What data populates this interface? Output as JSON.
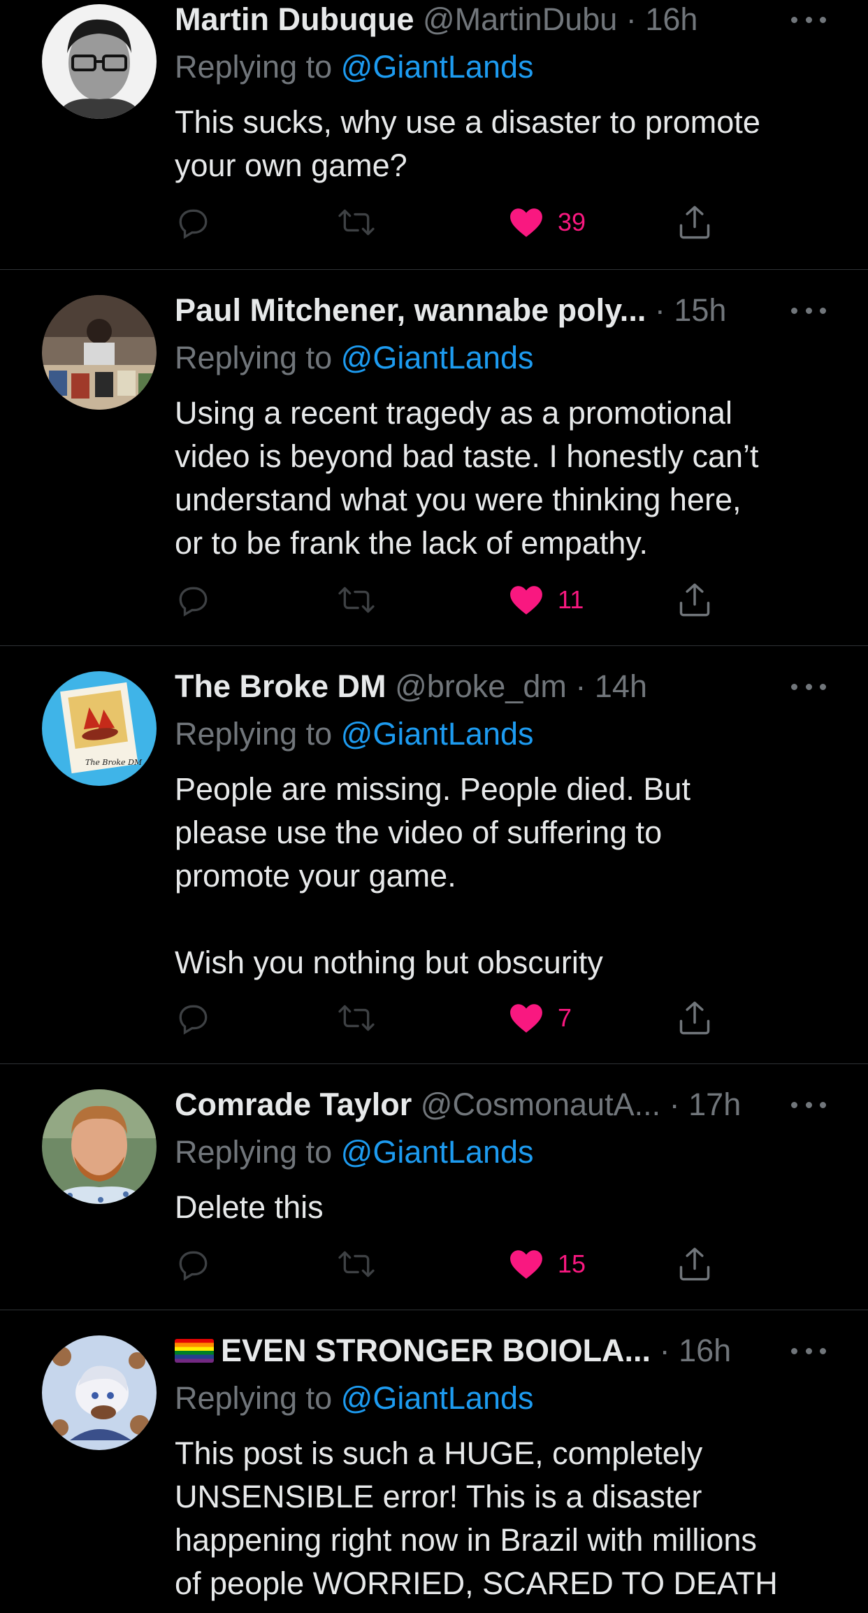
{
  "colors": {
    "background": "#000000",
    "text": "#e7e9ea",
    "muted": "#71767b",
    "link": "#1d9bf0",
    "like": "#f91880",
    "divider": "#2f3336"
  },
  "tweets": [
    {
      "name": "Martin Dubuque",
      "handle": "@MartinDubu",
      "dot": "·",
      "time": "16h",
      "reply_prefix": "Replying to",
      "reply_handle": "@GiantLands",
      "text": "This sucks, why use a disaster to promote\nyour own game?",
      "likes": "39",
      "liked": true,
      "icons": [
        "reply-icon",
        "retweet-icon",
        "like-heart-icon",
        "share-icon",
        "more-icon"
      ]
    },
    {
      "name": "Paul Mitchener, wannabe poly...",
      "handle": "",
      "dot": "·",
      "time": "15h",
      "reply_prefix": "Replying to",
      "reply_handle": "@GiantLands",
      "text": "Using a recent tragedy as a promotional\nvideo is beyond bad taste. I honestly can’t\nunderstand what you were thinking here,\nor to be frank the lack of empathy.",
      "likes": "11",
      "liked": true
    },
    {
      "name": "The Broke DM",
      "handle": "@broke_dm",
      "dot": "·",
      "time": "14h",
      "reply_prefix": "Replying to",
      "reply_handle": "@GiantLands",
      "text": "People are missing.  People died.  But\nplease use the video of suffering to\npromote your game.\n\nWish you nothing but obscurity",
      "likes": "7",
      "liked": true,
      "avatar_caption": "The Broke DM"
    },
    {
      "name": "Comrade Taylor",
      "handle": "@CosmonautA...",
      "dot": "·",
      "time": "17h",
      "reply_prefix": "Replying to",
      "reply_handle": "@GiantLands",
      "text": "Delete this",
      "likes": "15",
      "liked": true
    },
    {
      "name": "EVEN STRONGER BOIOLA...",
      "handle": "",
      "dot": "·",
      "time": "16h",
      "reply_prefix": "Replying to",
      "reply_handle": "@GiantLands",
      "text": "This post is such a HUGE, completely\nUNSENSIBLE error! This is a disaster\nhappening right now in Brazil with millions\nof people WORRIED, SCARED TO DEATH",
      "name_emoji": "rainbow-flag-icon"
    }
  ]
}
